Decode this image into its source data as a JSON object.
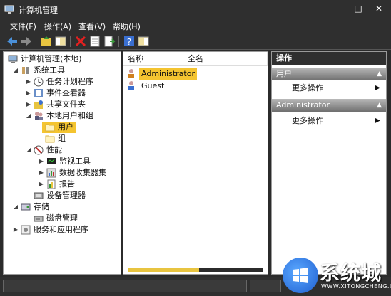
{
  "window": {
    "title": "计算机管理"
  },
  "menu": [
    "文件(F)",
    "操作(A)",
    "查看(V)",
    "帮助(H)"
  ],
  "tree": [
    {
      "label": "计算机管理(本地)",
      "icon": "computer-icon",
      "expander": ""
    },
    {
      "label": "系统工具",
      "icon": "tools-icon",
      "expander": "◢"
    },
    {
      "label": "任务计划程序",
      "icon": "clock-icon",
      "expander": "▶"
    },
    {
      "label": "事件查看器",
      "icon": "event-viewer-icon",
      "expander": "▶"
    },
    {
      "label": "共享文件夹",
      "icon": "shared-folder-icon",
      "expander": "▶"
    },
    {
      "label": "本地用户和组",
      "icon": "users-icon",
      "expander": "◢"
    },
    {
      "label": "用户",
      "icon": "folder-icon",
      "expander": ""
    },
    {
      "label": "组",
      "icon": "folder-icon",
      "expander": ""
    },
    {
      "label": "性能",
      "icon": "performance-icon",
      "expander": "◢"
    },
    {
      "label": "监视工具",
      "icon": "monitor-icon",
      "expander": "▶"
    },
    {
      "label": "数据收集器集",
      "icon": "data-collector-icon",
      "expander": "▶"
    },
    {
      "label": "报告",
      "icon": "report-icon",
      "expander": "▶"
    },
    {
      "label": "设备管理器",
      "icon": "device-manager-icon",
      "expander": ""
    },
    {
      "label": "存储",
      "icon": "storage-icon",
      "expander": "◢"
    },
    {
      "label": "磁盘管理",
      "icon": "disk-icon",
      "expander": ""
    },
    {
      "label": "服务和应用程序",
      "icon": "services-icon",
      "expander": "▶"
    }
  ],
  "list": {
    "columns": [
      "名称",
      "全名"
    ],
    "rows": [
      {
        "name": "Administrator",
        "icon": "user-icon",
        "selected": true
      },
      {
        "name": "Guest",
        "icon": "user-icon",
        "selected": false
      }
    ]
  },
  "actions": {
    "title": "操作",
    "sections": [
      {
        "header": "用户",
        "item": "更多操作"
      },
      {
        "header": "Administrator",
        "item": "更多操作"
      }
    ]
  },
  "watermark": {
    "text": "系统城",
    "url": "WWW.XITONGCHENG.COM"
  },
  "colors": {
    "accent": "#f4c430",
    "chrome": "#2f2f2f"
  }
}
